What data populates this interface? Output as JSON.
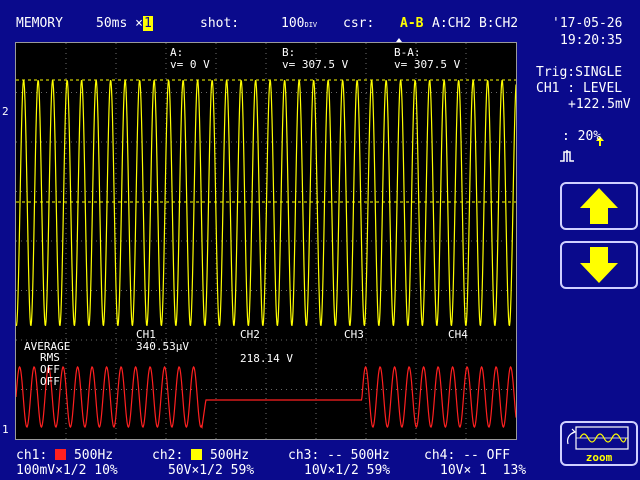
{
  "header": {
    "mode": "MEMORY",
    "timebase": "50ms ×",
    "timebase_multiplier": "1",
    "shot_label": "shot:",
    "shot_value": "100",
    "shot_unit": "DIV",
    "csr_label": "csr:",
    "csr_icon": "up-down-arrow-icon",
    "csr_pair": "A-B",
    "csr_channels": "A:CH2 B:CH2",
    "date": "'17-05-26",
    "time": "19:20:35"
  },
  "cursor_readout": {
    "a_label": "A:",
    "a_value": "v= 0 V",
    "b_label": "B:",
    "b_value": "v= 307.5 V",
    "ba_label": "B-A:",
    "ba_value": "v= 307.5 V"
  },
  "trigger": {
    "line1": "Trig:SINGLE",
    "line2": "CH1 : LEVEL",
    "line3": "+122.5mV",
    "slope_icon": "rising-edge-arrow-icon",
    "position_icon": "trigger-position-icon",
    "position_value": ": 20%"
  },
  "channel_markers": {
    "ch2": "2",
    "ch1": "1"
  },
  "measurements": {
    "mode": "AVERAGE",
    "items": [
      "RMS",
      "OFF",
      "OFF"
    ],
    "headers": [
      "CH1",
      "CH2",
      "CH3",
      "CH4"
    ],
    "ch1_value": "340.53µV",
    "ch2_value": "218.14 V"
  },
  "bottom_bar": {
    "ch1_label": "ch1:",
    "ch1_freq": "500Hz",
    "ch1_color": "#ff2020",
    "ch1_scale": "100mV×1/2 10%",
    "ch2_label": "ch2:",
    "ch2_freq": "500Hz",
    "ch2_color": "#ffff00",
    "ch2_scale": "50V×1/2 59%",
    "ch3_label": "ch3:",
    "ch3_freq": "-- 500Hz",
    "ch3_scale": "10V×1/2 59%",
    "ch4_label": "ch4:",
    "ch4_freq": "-- OFF",
    "ch4_scale": "10V× 1  13%"
  },
  "buttons": {
    "up_icon": "arrow-up-icon",
    "down_icon": "arrow-down-icon",
    "zoom_label": "zoom",
    "zoom_icon": "waveform-zoom-icon"
  },
  "colors": {
    "background": "#0a0a8c",
    "ch1_trace": "#ff2020",
    "ch2_trace": "#ffff00",
    "grid": "#8a8a8a"
  }
}
